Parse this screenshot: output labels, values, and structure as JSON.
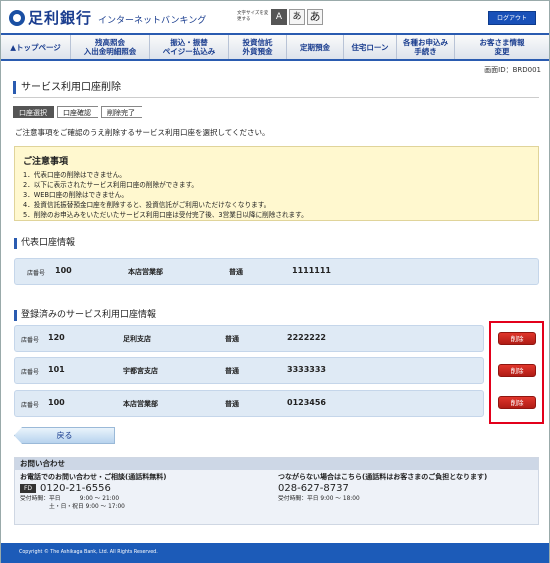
{
  "header": {
    "bank_name": "足利銀行",
    "service_name": "インターネットバンキング",
    "font_size_label": "文字サイズを変更する",
    "font_sizes": [
      "A",
      "あ",
      "あ"
    ],
    "logout_label": "ログアウト"
  },
  "nav": {
    "items": [
      {
        "label": "▲トップページ"
      },
      {
        "label": "残高照会\n入出金明細照会"
      },
      {
        "label": "振込・振替\nペイジー払込み"
      },
      {
        "label": "投資信託\n外貨預金"
      },
      {
        "label": "定期預金"
      },
      {
        "label": "住宅ローン"
      },
      {
        "label": "各種お申込み\n手続き"
      },
      {
        "label": "お客さま情報\n変更"
      }
    ]
  },
  "screen_id": "画面ID：BRD001",
  "page_title": "サービス利用口座削除",
  "steps": [
    "口座選択",
    "口座確認",
    "削除完了"
  ],
  "lead_text": "ご注意事項をご確認のうえ削除するサービス利用口座を選択してください。",
  "notice": {
    "title": "ご注意事項",
    "lines": [
      "1．代表口座の削除はできません。",
      "2．以下に表示されたサービス利用口座の削除ができます。",
      "3．WEB口座の削除はできません。",
      "4．投資信託振替預金口座を削除すると、投資信託がご利用いただけなくなります。",
      "5．削除のお申込みをいただいたサービス利用口座は受付完了後、3営業日以降に削除されます。"
    ]
  },
  "representative": {
    "section_title": "代表口座情報",
    "account": {
      "branch_label": "店番号",
      "branch_no": "100",
      "branch_name": "本店営業部",
      "type": "普通",
      "number": "1111111"
    }
  },
  "registered": {
    "section_title": "登録済みのサービス利用口座情報",
    "delete_label": "削除",
    "accounts": [
      {
        "branch_label": "店番号",
        "branch_no": "120",
        "branch_name": "足利支店",
        "type": "普通",
        "number": "2222222"
      },
      {
        "branch_label": "店番号",
        "branch_no": "101",
        "branch_name": "宇都宮支店",
        "type": "普通",
        "number": "3333333"
      },
      {
        "branch_label": "店番号",
        "branch_no": "100",
        "branch_name": "本店営業部",
        "type": "普通",
        "number": "0123456"
      }
    ]
  },
  "back_label": "戻る",
  "contact": {
    "title": "お問い合わせ",
    "left": {
      "heading": "お電話でのお問い合わせ・ご相談(通話料無料)",
      "phone_icon": "FD",
      "phone": "0120-21-6556",
      "hours1": "受付時間：平日　　　 9:00 ～ 21:00",
      "hours2": "　　　　　土・日・祝日 9:00 ～ 17:00"
    },
    "right": {
      "heading": "つながらない場合はこちら(通話料はお客さまのご負担となります)",
      "phone": "028-627-8737",
      "hours1": "受付時間：平日 9:00 ～ 18:00"
    }
  },
  "footer": "Copyright © The Ashikaga Bank, Ltd. All Rights Reserved."
}
